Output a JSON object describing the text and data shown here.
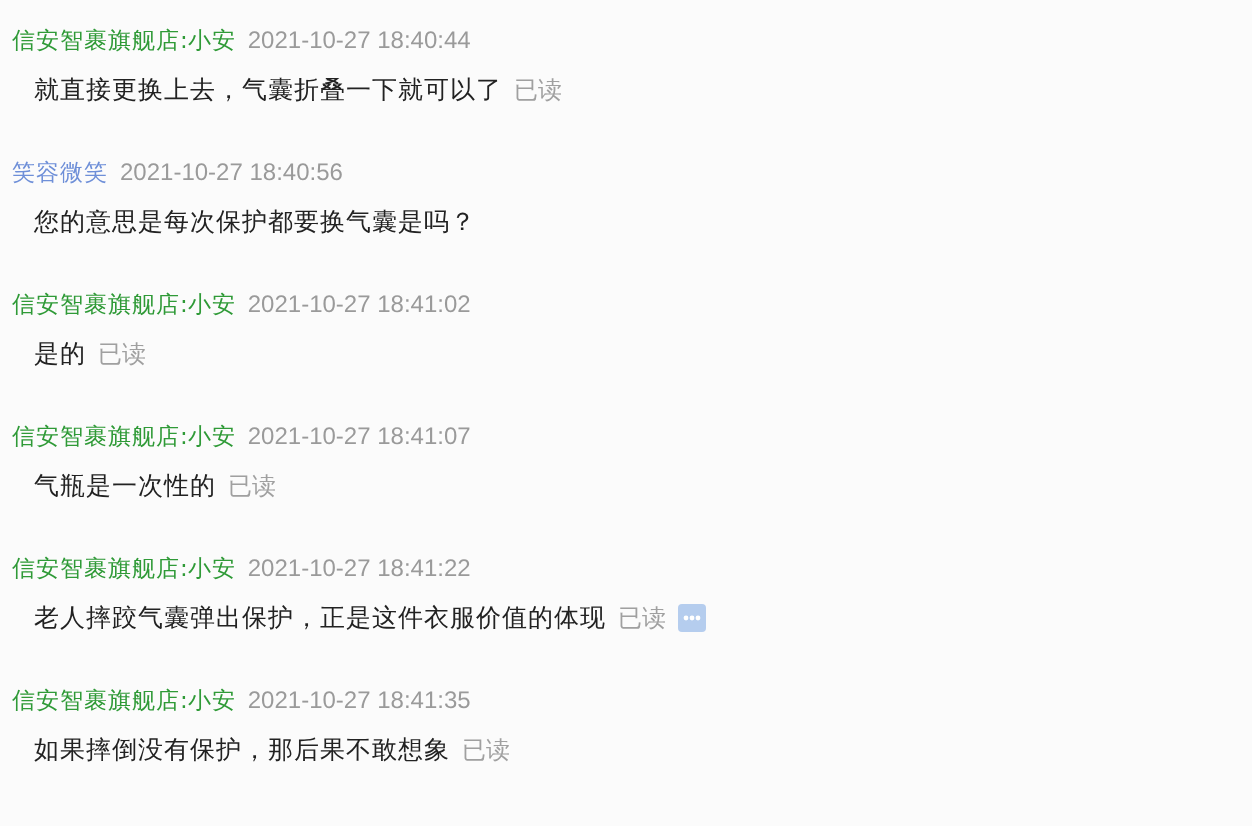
{
  "messages": [
    {
      "sender": "信安智裹旗舰店:小安",
      "color": "#2f9a37",
      "time": "2021-10-27 18:40:44",
      "text": "就直接更换上去，气囊折叠一下就可以了",
      "status": "已读",
      "has_more": false
    },
    {
      "sender": "笑容微笑",
      "color": "#6e8fd8",
      "time": "2021-10-27 18:40:56",
      "text": "您的意思是每次保护都要换气囊是吗？",
      "has_more": false
    },
    {
      "sender": "信安智裹旗舰店:小安",
      "color": "#2f9a37",
      "time": "2021-10-27 18:41:02",
      "text": "是的",
      "status": "已读",
      "has_more": false
    },
    {
      "sender": "信安智裹旗舰店:小安",
      "color": "#2f9a37",
      "time": "2021-10-27 18:41:07",
      "text": "气瓶是一次性的",
      "status": "已读",
      "has_more": false
    },
    {
      "sender": "信安智裹旗舰店:小安",
      "color": "#2f9a37",
      "time": "2021-10-27 18:41:22",
      "text": "老人摔跤气囊弹出保护，正是这件衣服价值的体现",
      "status": "已读",
      "has_more": true
    },
    {
      "sender": "信安智裹旗舰店:小安",
      "color": "#2f9a37",
      "time": "2021-10-27 18:41:35",
      "text": "如果摔倒没有保护，那后果不敢想象",
      "status": "已读",
      "has_more": false
    }
  ]
}
